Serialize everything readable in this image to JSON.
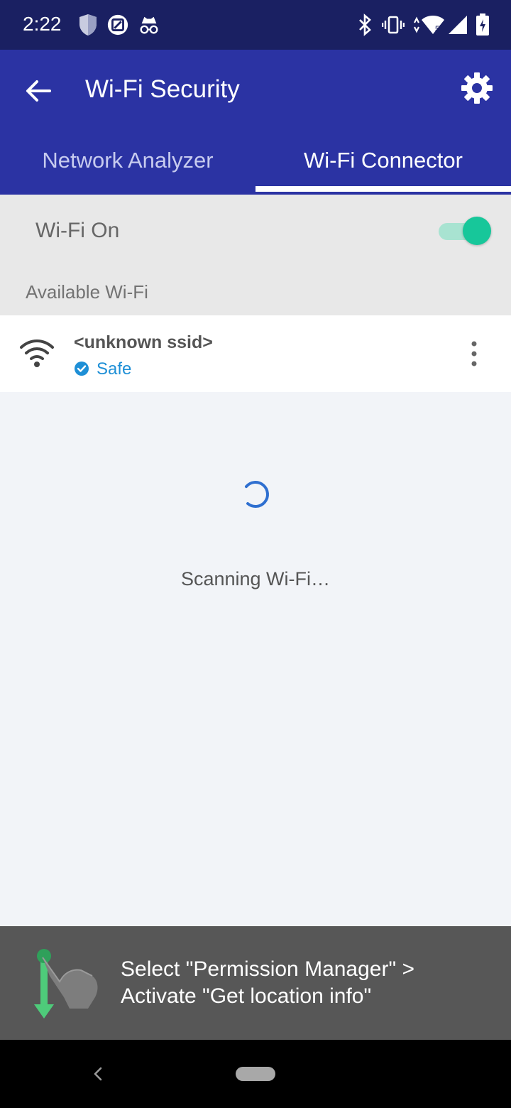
{
  "status_bar": {
    "time": "2:22",
    "left_icons": [
      "shield-icon",
      "screenshot-icon",
      "incognito-icon"
    ],
    "right_icons": [
      "bluetooth-icon",
      "vibrate-icon",
      "wifi-data-icon",
      "signal-icon",
      "battery-charging-icon"
    ],
    "background": "#1a2062"
  },
  "app_bar": {
    "title": "Wi-Fi Security",
    "back_icon": "arrow-left-icon",
    "settings_icon": "gear-icon",
    "background": "#2b33a3"
  },
  "tabs": [
    {
      "label": "Network Analyzer",
      "selected": false
    },
    {
      "label": "Wi-Fi Connector",
      "selected": true
    }
  ],
  "wifi_toggle": {
    "label": "Wi-Fi On",
    "on": true,
    "accent": "#17c79a"
  },
  "available": {
    "title": "Available Wi-Fi",
    "networks": [
      {
        "ssid": "<unknown ssid>",
        "status": "Safe",
        "status_color": "#1e8fd6",
        "icon": "wifi-icon",
        "menu_icon": "more-vertical-icon"
      }
    ]
  },
  "scanning": {
    "text": "Scanning Wi-Fi…",
    "spinner_color": "#2f6fd0"
  },
  "hint": {
    "line1": "Select \"Permission Manager\" >",
    "line2": "Activate \"Get location info\"",
    "icon": "swipe-down-hand-icon"
  },
  "nav_bar": {
    "back_icon": "nav-back-icon",
    "home_icon": "home-pill-icon"
  }
}
